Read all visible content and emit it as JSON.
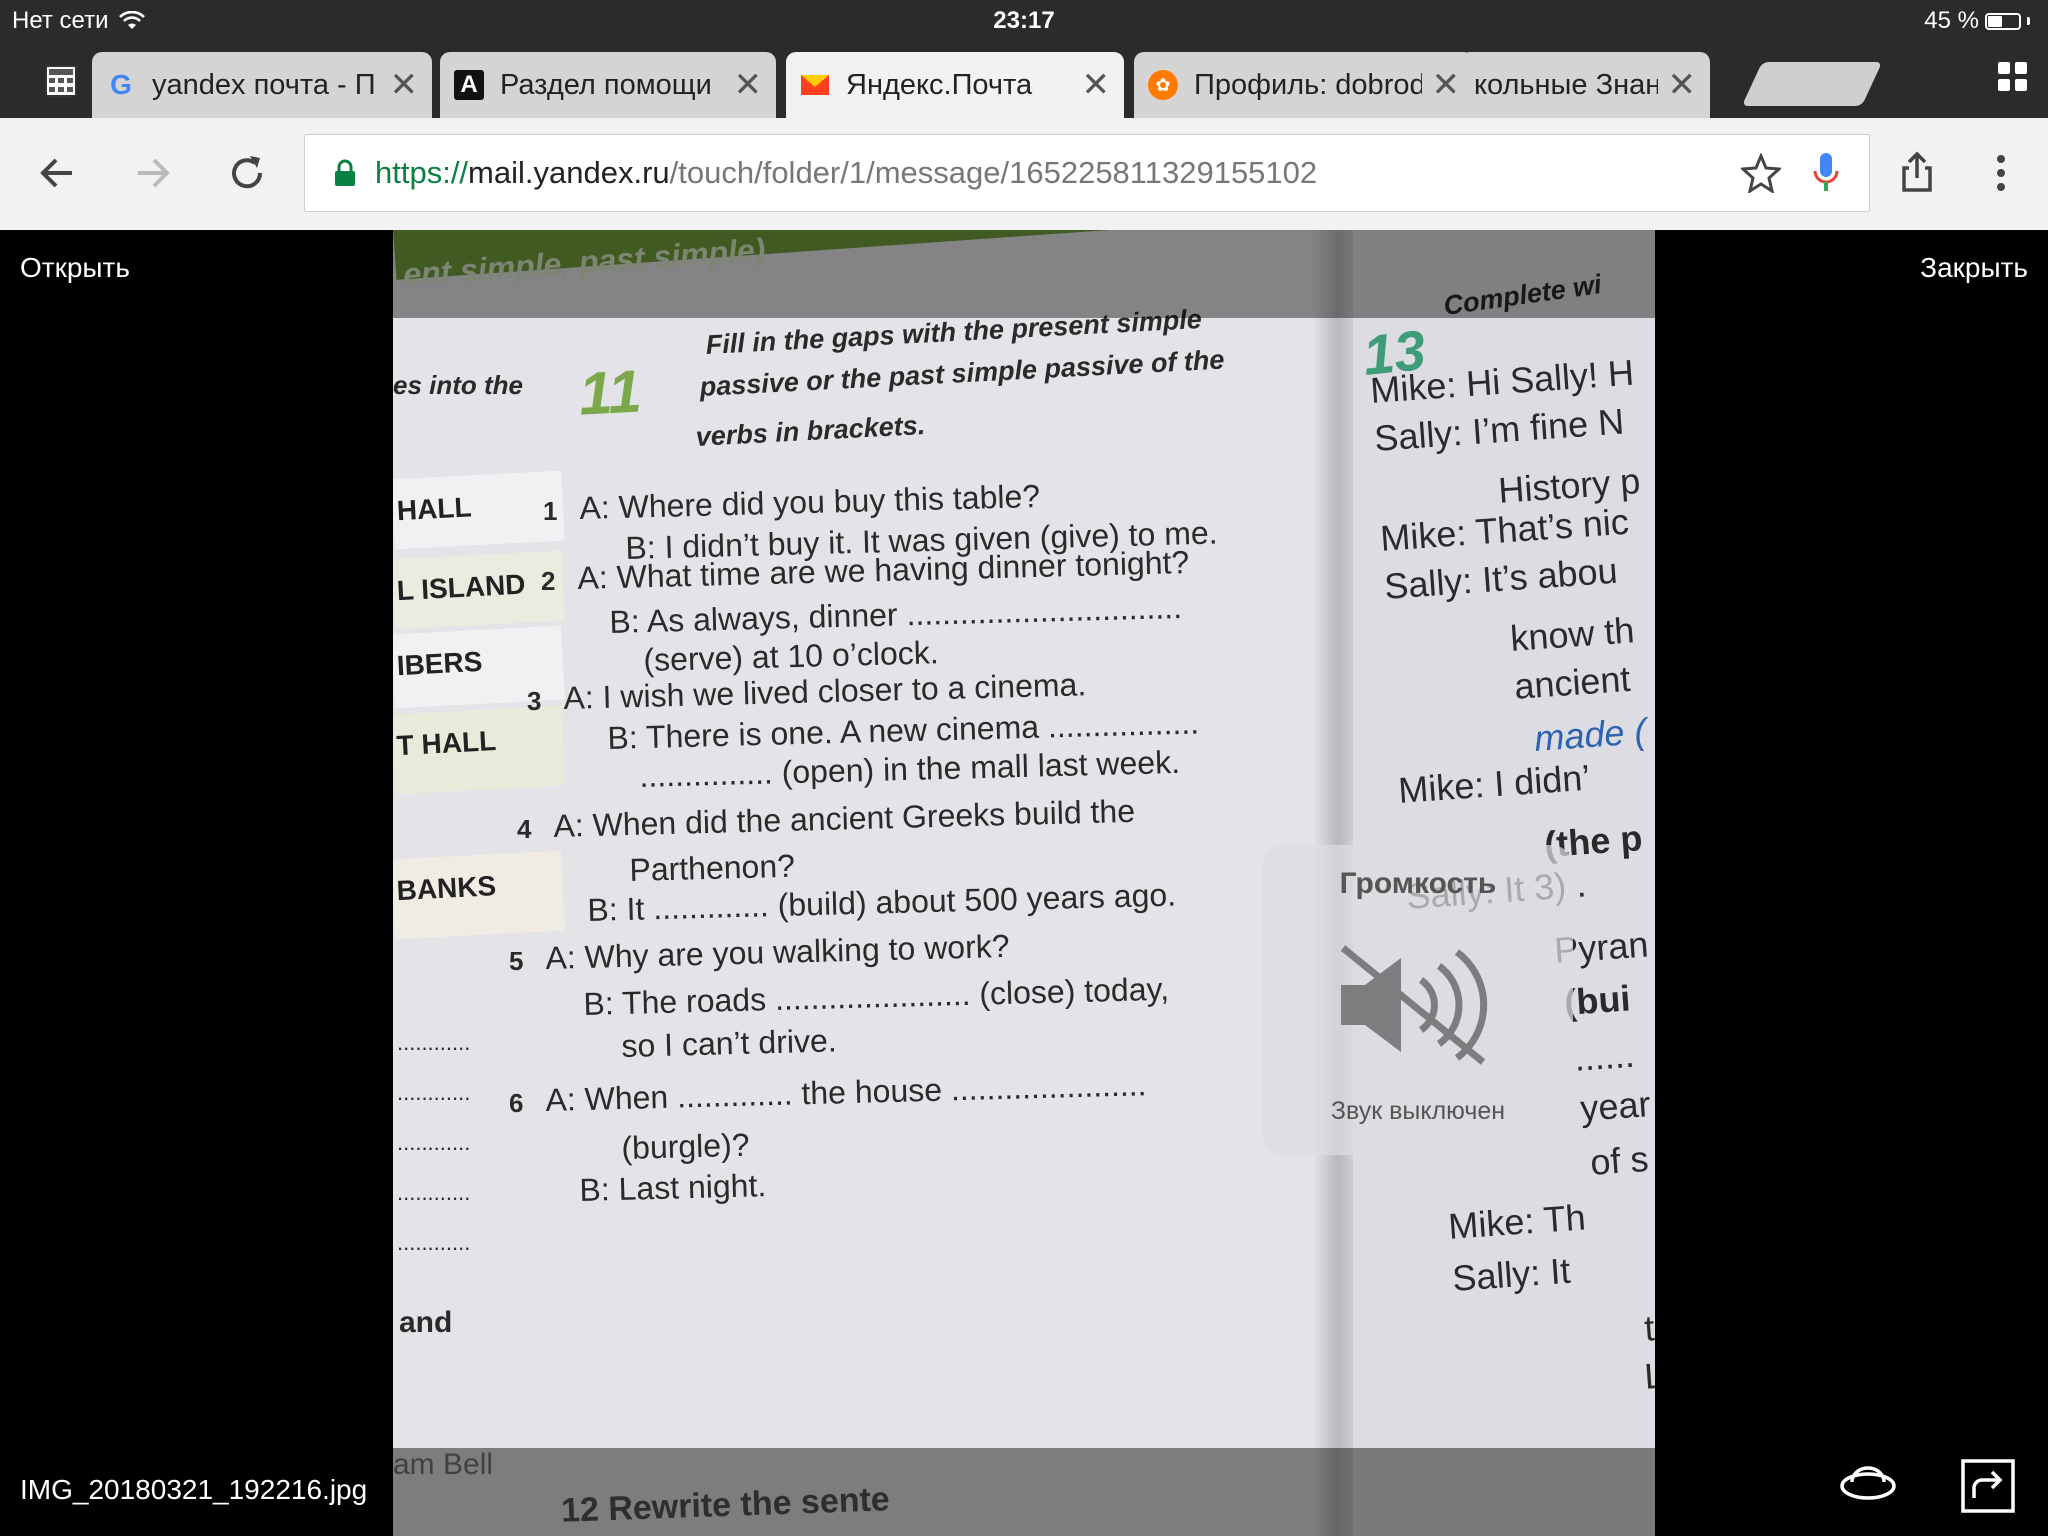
{
  "status_bar": {
    "network": "Нет сети",
    "time": "23:17",
    "battery": "45 %",
    "battery_level": 0.45
  },
  "tabs": [
    {
      "title": "yandex почта - П",
      "icon": "google-icon"
    },
    {
      "title": "Раздел помощи",
      "icon": "a-letter-icon"
    },
    {
      "title": "Яндекс.Почта",
      "icon": "yandex-mail-icon",
      "active": true
    },
    {
      "title": "Профиль: dobrod",
      "icon": "profile-site-icon"
    },
    {
      "title": "кольные Знан",
      "icon": "none"
    }
  ],
  "url": {
    "scheme": "https://",
    "host": "mail.yandex.ru",
    "path": "/touch/folder/1/message/165225811329155102"
  },
  "viewer": {
    "open_label": "Открыть",
    "close_label": "Закрыть",
    "filename": "IMG_20180321_192216.jpg"
  },
  "hud": {
    "title": "Громкость",
    "subtitle": "Звук выключен"
  },
  "book": {
    "header_band": "ent simple, past simple)",
    "left_cut": "es into the",
    "side_tabs": [
      "HALL",
      "L ISLAND",
      "IBERS",
      "T HALL",
      "BANKS"
    ],
    "left_dots": [
      "............",
      "............",
      "............",
      "............",
      "............"
    ],
    "left_and": "and",
    "left_bottom": "am Bell",
    "ex_number": "11",
    "ex_instruction": [
      "Fill in the gaps with the present simple",
      "passive or the past simple passive of the",
      "verbs in brackets."
    ],
    "lines": [
      {
        "n": "1",
        "text": "A:  Where did you buy this table?"
      },
      {
        "n": "",
        "text": "B:  I didn’t buy it. It was given (give) to me."
      },
      {
        "n": "2",
        "text": "A:  What time are we having dinner tonight?"
      },
      {
        "n": "",
        "text": "B:  As always, dinner ..............................."
      },
      {
        "n": "",
        "text": "(serve) at 10 o’clock."
      },
      {
        "n": "3",
        "text": "A:  I wish we lived closer to a cinema."
      },
      {
        "n": "",
        "text": "B:  There is one. A new cinema ................."
      },
      {
        "n": "",
        "text": "............... (open) in the mall last week."
      },
      {
        "n": "4",
        "text": "A:  When did the ancient Greeks build the"
      },
      {
        "n": "",
        "text": "Parthenon?"
      },
      {
        "n": "",
        "text": "B:  It ............. (build) about 500 years ago."
      },
      {
        "n": "5",
        "text": "A:  Why are you walking to work?"
      },
      {
        "n": "",
        "text": "B:  The roads ...................... (close) today,"
      },
      {
        "n": "",
        "text": "so I can’t drive."
      },
      {
        "n": "6",
        "text": "A:  When ............. the house ......................"
      },
      {
        "n": "",
        "text": "(burgle)?"
      },
      {
        "n": "",
        "text": "B:  Last night."
      }
    ],
    "ex12": "12 Rewrite the sente",
    "ex13_number": "13",
    "ex13_title": "Complete wi",
    "right_lines": [
      "Mike:  Hi Sally! H",
      "Sally:  I’m fine N",
      "History p",
      "Mike:  That’s nic",
      "Sally:  It’s abou",
      "know th",
      "ancient",
      "made (",
      "Mike:  I didn’",
      "(the p",
      "Sally:  It 3) .",
      "Pyran",
      "(bui",
      "......",
      "year",
      "of s",
      "Mike:  Th",
      "Sally:  It",
      "ta",
      "Li"
    ]
  }
}
